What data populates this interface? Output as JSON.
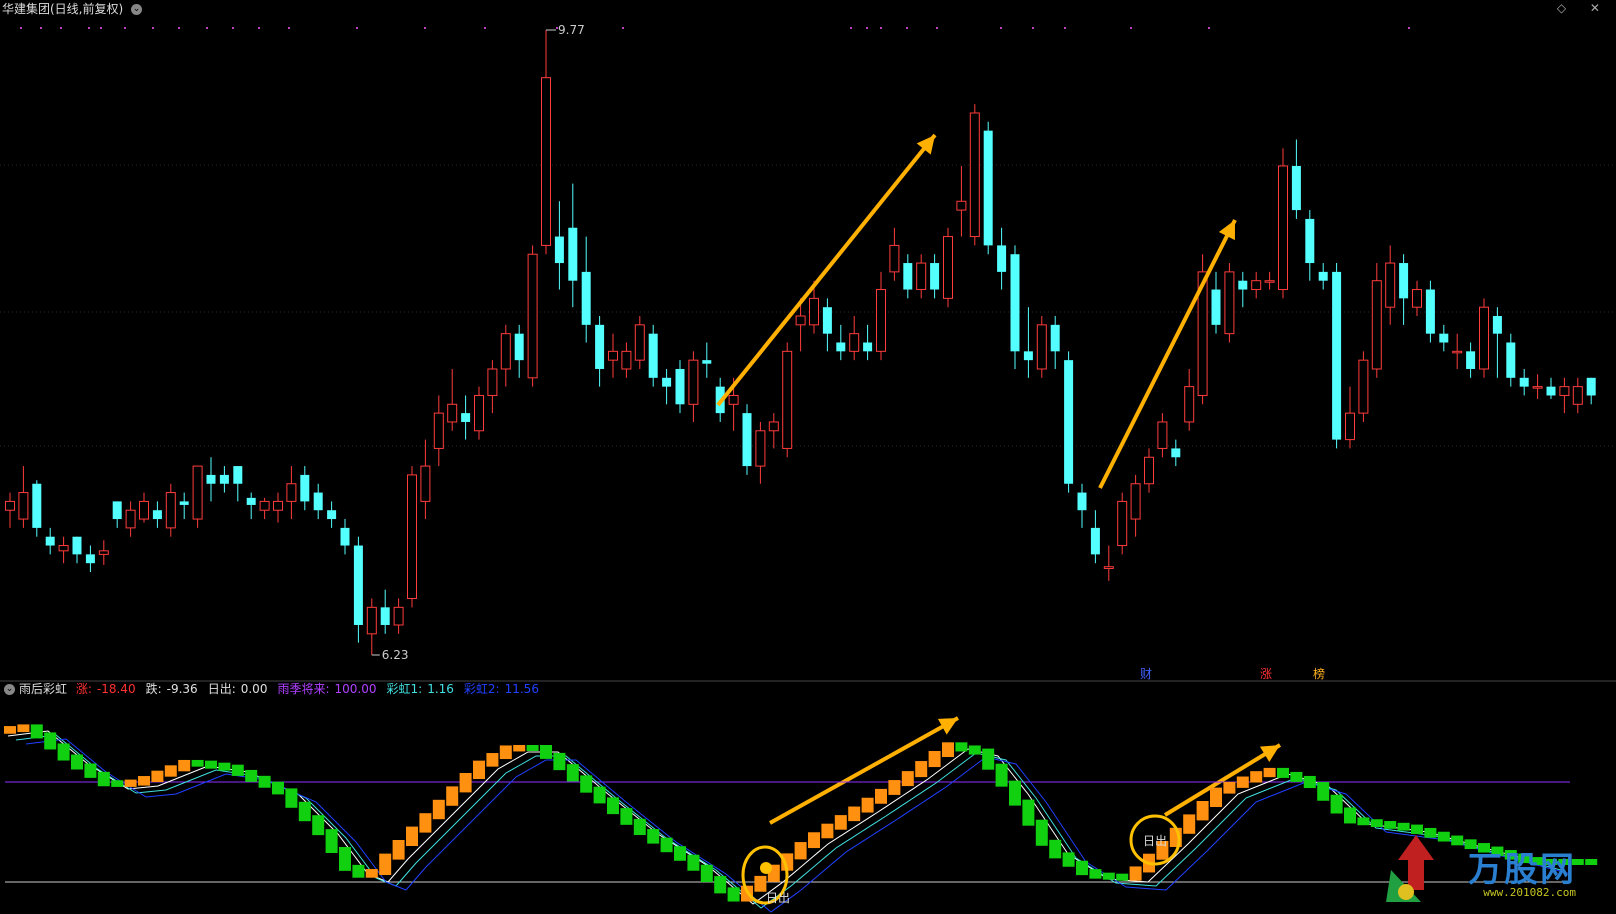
{
  "header": {
    "title": "华建集团(日线,前复权)",
    "corner_icons": "◇ ✕"
  },
  "indicator": {
    "name": "雨后彩虹",
    "fields": [
      {
        "label": "涨:",
        "value": "-18.40",
        "color": "#ff3030"
      },
      {
        "label": "跌:",
        "value": "-9.36",
        "color": "#e0e0e0"
      },
      {
        "label": "日出:",
        "value": "0.00",
        "color": "#e0e0e0"
      },
      {
        "label": "雨季将来:",
        "value": "100.00",
        "color": "#b040ff"
      },
      {
        "label": "彩虹1:",
        "value": "1.16",
        "color": "#40e0e0"
      },
      {
        "label": "彩虹2:",
        "value": "11.56",
        "color": "#2040ff"
      }
    ]
  },
  "chart_data": {
    "type": "candlestick",
    "high_label": "9.77",
    "low_label": "6.23",
    "candles": [
      [
        7.05,
        7.1,
        6.95,
        7.15
      ],
      [
        7.0,
        7.15,
        6.95,
        7.3
      ],
      [
        7.2,
        6.95,
        6.9,
        7.22
      ],
      [
        6.9,
        6.85,
        6.8,
        6.95
      ],
      [
        6.82,
        6.85,
        6.75,
        6.9
      ],
      [
        6.9,
        6.8,
        6.75,
        6.9
      ],
      [
        6.8,
        6.75,
        6.7,
        6.85
      ],
      [
        6.8,
        6.82,
        6.74,
        6.88
      ],
      [
        7.1,
        7.0,
        6.95,
        7.1
      ],
      [
        6.95,
        7.05,
        6.9,
        7.1
      ],
      [
        7.0,
        7.1,
        6.98,
        7.15
      ],
      [
        7.05,
        7.0,
        6.95,
        7.1
      ],
      [
        6.95,
        7.15,
        6.9,
        7.2
      ],
      [
        7.1,
        7.08,
        7.0,
        7.15
      ],
      [
        7.0,
        7.3,
        6.95,
        7.3
      ],
      [
        7.25,
        7.2,
        7.1,
        7.35
      ],
      [
        7.25,
        7.2,
        7.15,
        7.3
      ],
      [
        7.3,
        7.2,
        7.1,
        7.3
      ],
      [
        7.12,
        7.08,
        7.0,
        7.15
      ],
      [
        7.05,
        7.1,
        7.0,
        7.12
      ],
      [
        7.05,
        7.1,
        6.98,
        7.15
      ],
      [
        7.1,
        7.2,
        7.0,
        7.3
      ],
      [
        7.25,
        7.1,
        7.05,
        7.3
      ],
      [
        7.15,
        7.05,
        7.0,
        7.2
      ],
      [
        7.05,
        7.0,
        6.95,
        7.1
      ],
      [
        6.95,
        6.85,
        6.8,
        7.0
      ],
      [
        6.85,
        6.4,
        6.3,
        6.9
      ],
      [
        6.35,
        6.5,
        6.23,
        6.55
      ],
      [
        6.5,
        6.4,
        6.35,
        6.6
      ],
      [
        6.4,
        6.5,
        6.35,
        6.55
      ],
      [
        6.55,
        7.25,
        6.5,
        7.3
      ],
      [
        7.1,
        7.3,
        7.0,
        7.45
      ],
      [
        7.4,
        7.6,
        7.3,
        7.7
      ],
      [
        7.55,
        7.65,
        7.5,
        7.85
      ],
      [
        7.6,
        7.55,
        7.45,
        7.7
      ],
      [
        7.5,
        7.7,
        7.45,
        7.75
      ],
      [
        7.7,
        7.85,
        7.6,
        7.9
      ],
      [
        7.85,
        8.05,
        7.75,
        8.1
      ],
      [
        8.05,
        7.9,
        7.8,
        8.1
      ],
      [
        7.8,
        8.5,
        7.75,
        8.55
      ],
      [
        8.55,
        9.5,
        8.5,
        9.77
      ],
      [
        8.6,
        8.45,
        8.3,
        8.8
      ],
      [
        8.65,
        8.35,
        8.2,
        8.9
      ],
      [
        8.4,
        8.1,
        8.0,
        8.6
      ],
      [
        8.1,
        7.85,
        7.75,
        8.15
      ],
      [
        7.9,
        7.95,
        7.8,
        8.05
      ],
      [
        7.85,
        7.95,
        7.8,
        8.0
      ],
      [
        7.9,
        8.1,
        7.85,
        8.15
      ],
      [
        8.05,
        7.8,
        7.75,
        8.1
      ],
      [
        7.8,
        7.75,
        7.65,
        7.85
      ],
      [
        7.85,
        7.65,
        7.6,
        7.9
      ],
      [
        7.65,
        7.9,
        7.55,
        7.95
      ],
      [
        7.9,
        7.88,
        7.8,
        8.0
      ],
      [
        7.75,
        7.6,
        7.55,
        7.8
      ],
      [
        7.65,
        7.7,
        7.5,
        7.8
      ],
      [
        7.6,
        7.3,
        7.25,
        7.65
      ],
      [
        7.3,
        7.5,
        7.2,
        7.55
      ],
      [
        7.5,
        7.55,
        7.4,
        7.6
      ],
      [
        7.4,
        7.95,
        7.35,
        8.0
      ],
      [
        8.1,
        8.15,
        7.95,
        8.25
      ],
      [
        8.1,
        8.25,
        8.05,
        8.35
      ],
      [
        8.2,
        8.05,
        7.95,
        8.25
      ],
      [
        8.0,
        7.95,
        7.9,
        8.1
      ],
      [
        7.95,
        8.05,
        7.9,
        8.15
      ],
      [
        8.0,
        7.95,
        7.9,
        8.1
      ],
      [
        7.95,
        8.3,
        7.9,
        8.4
      ],
      [
        8.4,
        8.55,
        8.35,
        8.65
      ],
      [
        8.45,
        8.3,
        8.25,
        8.5
      ],
      [
        8.3,
        8.45,
        8.25,
        8.5
      ],
      [
        8.45,
        8.3,
        8.25,
        8.5
      ],
      [
        8.25,
        8.6,
        8.2,
        8.65
      ],
      [
        8.75,
        8.8,
        8.6,
        9.0
      ],
      [
        8.6,
        9.3,
        8.55,
        9.35
      ],
      [
        9.2,
        8.55,
        8.5,
        9.25
      ],
      [
        8.55,
        8.4,
        8.3,
        8.65
      ],
      [
        8.5,
        7.95,
        7.85,
        8.55
      ],
      [
        7.95,
        7.9,
        7.8,
        8.2
      ],
      [
        7.85,
        8.1,
        7.8,
        8.15
      ],
      [
        8.1,
        7.95,
        7.85,
        8.15
      ],
      [
        7.9,
        7.2,
        7.15,
        7.95
      ],
      [
        7.15,
        7.05,
        6.95,
        7.2
      ],
      [
        6.95,
        6.8,
        6.75,
        7.05
      ],
      [
        6.72,
        6.73,
        6.65,
        6.85
      ],
      [
        6.85,
        7.1,
        6.8,
        7.15
      ],
      [
        7.0,
        7.2,
        6.9,
        7.25
      ],
      [
        7.2,
        7.35,
        7.15,
        7.4
      ],
      [
        7.4,
        7.55,
        7.35,
        7.6
      ],
      [
        7.4,
        7.35,
        7.3,
        7.45
      ],
      [
        7.55,
        7.75,
        7.5,
        7.85
      ],
      [
        7.7,
        8.4,
        7.65,
        8.5
      ],
      [
        8.3,
        8.1,
        8.05,
        8.4
      ],
      [
        8.05,
        8.4,
        8.0,
        8.45
      ],
      [
        8.35,
        8.3,
        8.2,
        8.4
      ],
      [
        8.3,
        8.35,
        8.25,
        8.4
      ],
      [
        8.35,
        8.35,
        8.3,
        8.4
      ],
      [
        8.3,
        9.0,
        8.25,
        9.1
      ],
      [
        9.0,
        8.75,
        8.7,
        9.15
      ],
      [
        8.7,
        8.45,
        8.35,
        8.75
      ],
      [
        8.4,
        8.35,
        8.3,
        8.45
      ],
      [
        8.4,
        7.45,
        7.4,
        8.45
      ],
      [
        7.45,
        7.6,
        7.4,
        7.75
      ],
      [
        7.6,
        7.9,
        7.55,
        7.95
      ],
      [
        7.85,
        8.35,
        7.8,
        8.45
      ],
      [
        8.2,
        8.45,
        8.1,
        8.55
      ],
      [
        8.45,
        8.25,
        8.1,
        8.5
      ],
      [
        8.2,
        8.3,
        8.15,
        8.35
      ],
      [
        8.3,
        8.05,
        8.0,
        8.35
      ],
      [
        8.05,
        8.0,
        7.95,
        8.1
      ],
      [
        7.95,
        7.95,
        7.85,
        8.05
      ],
      [
        7.95,
        7.85,
        7.8,
        8.0
      ],
      [
        7.85,
        8.2,
        7.8,
        8.25
      ],
      [
        8.15,
        8.05,
        7.8,
        8.2
      ],
      [
        8.0,
        7.8,
        7.75,
        8.05
      ],
      [
        7.8,
        7.75,
        7.7,
        7.85
      ],
      [
        7.75,
        7.75,
        7.68,
        7.82
      ],
      [
        7.75,
        7.7,
        7.68,
        7.8
      ],
      [
        7.7,
        7.75,
        7.6,
        7.8
      ],
      [
        7.65,
        7.75,
        7.6,
        7.8
      ],
      [
        7.8,
        7.7,
        7.65,
        7.8
      ]
    ],
    "bottom_markers": [
      {
        "text": "财",
        "color": "#4060ff"
      },
      {
        "text": "涨",
        "color": "#ff3030"
      },
      {
        "text": "榜",
        "color": "#ffb020"
      }
    ],
    "indicator_series": {
      "lines": [
        {
          "name": "彩虹1",
          "color": "#40e0e0"
        },
        {
          "name": "彩虹2",
          "color": "#2040ff"
        }
      ],
      "level_line_value": "雨季将来 100.00",
      "annotation": "日出"
    }
  },
  "watermark": {
    "brand": "万股网",
    "url": "www.201082.com"
  }
}
